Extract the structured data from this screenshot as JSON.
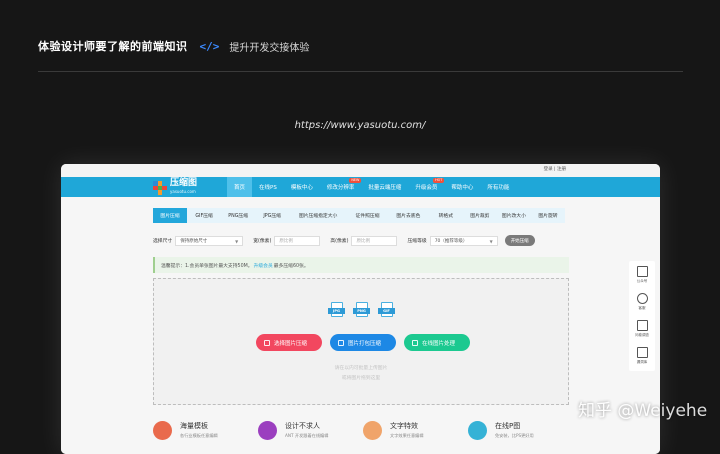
{
  "slide": {
    "title": "体验设计师要了解的前端知识",
    "code_icon": "</>",
    "subtitle": "提升开发交接体验",
    "url": "https://www.yasuotu.com/"
  },
  "site": {
    "topbar": {
      "login": "登录 | 注册"
    },
    "logo": {
      "name": "压缩图",
      "domain": "yasuotu.com"
    },
    "nav": [
      {
        "label": "首页",
        "active": true
      },
      {
        "label": "在线PS"
      },
      {
        "label": "模板中心"
      },
      {
        "label": "修改分辨率",
        "badge": "NEW"
      },
      {
        "label": "批量云端压缩"
      },
      {
        "label": "升级会员",
        "badge": "HOT"
      },
      {
        "label": "帮助中心"
      },
      {
        "label": "所有功能"
      }
    ],
    "tabs": [
      "图片压缩",
      "GIF压缩",
      "PNG压缩",
      "JPG压缩",
      "图片压缩指定大小",
      "证件照压缩",
      "图片去底色",
      "转格式",
      "图片裁剪",
      "图片改大小",
      "图片旋转"
    ],
    "options": {
      "size_label": "选择尺寸",
      "size_value": "保持原始尺寸",
      "width_label": "宽(像素)",
      "width_placeholder": "原比例",
      "height_label": "高(像素)",
      "height_placeholder": "原比例",
      "level_label": "压缩等级",
      "level_value": "70（推荐等级）",
      "start_button": "开始压缩"
    },
    "notice": {
      "prefix": "温馨提示：1.会员单张图片最大支持50M。",
      "link": "升级会员",
      "suffix": "最多压缩60张。"
    },
    "dropzone": {
      "file_types": [
        "JPG",
        "PNG",
        "GIF"
      ],
      "buttons": [
        "选择图片压缩",
        "图片打包压缩",
        "在线图片处理"
      ],
      "hint_line1": "请在以内可批量上传图片",
      "hint_line2": "或将图片拖到这里"
    },
    "features": [
      {
        "title": "海量模板",
        "desc": "各行业模板任意编辑",
        "color": "#e96a4c"
      },
      {
        "title": "设计不求人",
        "desc": "ANT 开发跟着在线编辑",
        "color": "#9b3fbf"
      },
      {
        "title": "文字特效",
        "desc": "文字效果任意编辑",
        "color": "#f0a46a"
      },
      {
        "title": "在线P图",
        "desc": "免安装，比PS更好用",
        "color": "#35b2d6"
      }
    ],
    "sidebar": [
      {
        "label": "公众号",
        "icon": "qrcode-icon"
      },
      {
        "label": "客服",
        "icon": "headset-icon"
      },
      {
        "label": "问卷调查",
        "icon": "clipboard-icon"
      },
      {
        "label": "漏洞库",
        "icon": "folder-icon"
      }
    ]
  },
  "watermark": "知乎 @Weiyehe"
}
